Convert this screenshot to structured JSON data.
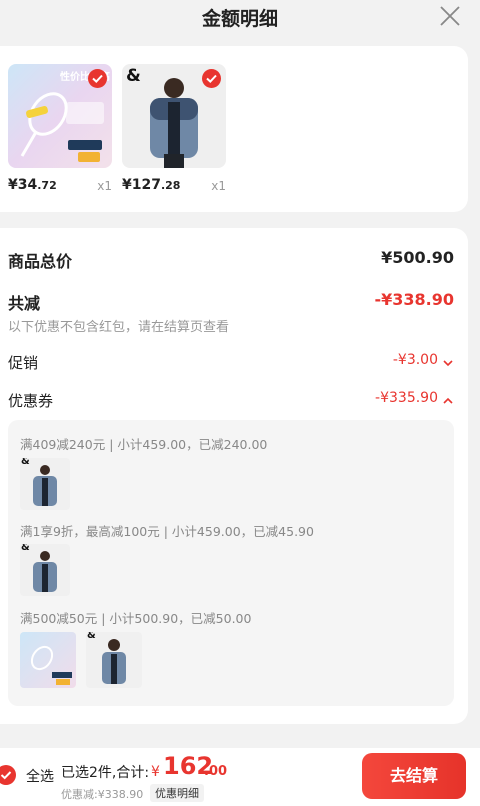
{
  "header": {
    "title": "金额明细"
  },
  "products": [
    {
      "price_int": "¥34",
      "price_dec": ".72",
      "qty": "x1",
      "img_text": "性价比超高"
    },
    {
      "price_int": "¥127",
      "price_dec": ".28",
      "qty": "x1",
      "brand_mark": "&"
    }
  ],
  "summary": {
    "goods_total_label": "商品总价",
    "goods_total_value": "¥500.90",
    "reduce_label": "共减",
    "reduce_value": "-¥338.90",
    "reduce_note": "以下优惠不包含红包，请在结算页查看",
    "promo_label": "促销",
    "promo_value": "-¥3.00",
    "coupon_label": "优惠券",
    "coupon_value": "-¥335.90"
  },
  "coupons": [
    {
      "text": "满409减240元 | 小计459.00，已减240.00",
      "brand_mark": "&"
    },
    {
      "text": "满1享9折，最高减100元 | 小计459.00，已减45.90",
      "brand_mark": "&"
    },
    {
      "text": "满500减50元 | 小计500.90，已减50.00",
      "brand_mark": "&"
    }
  ],
  "bottom": {
    "select_all": "全选",
    "selected_summary": "已选2件,合计:",
    "total_symbol": "¥",
    "total_int": "162",
    "total_dec": ".00",
    "discount_text": "优惠减:¥338.90",
    "detail_button": "优惠明细",
    "checkout_button": "去结算"
  },
  "colors": {
    "accent": "#e8352f",
    "background": "#f2f2f2"
  }
}
